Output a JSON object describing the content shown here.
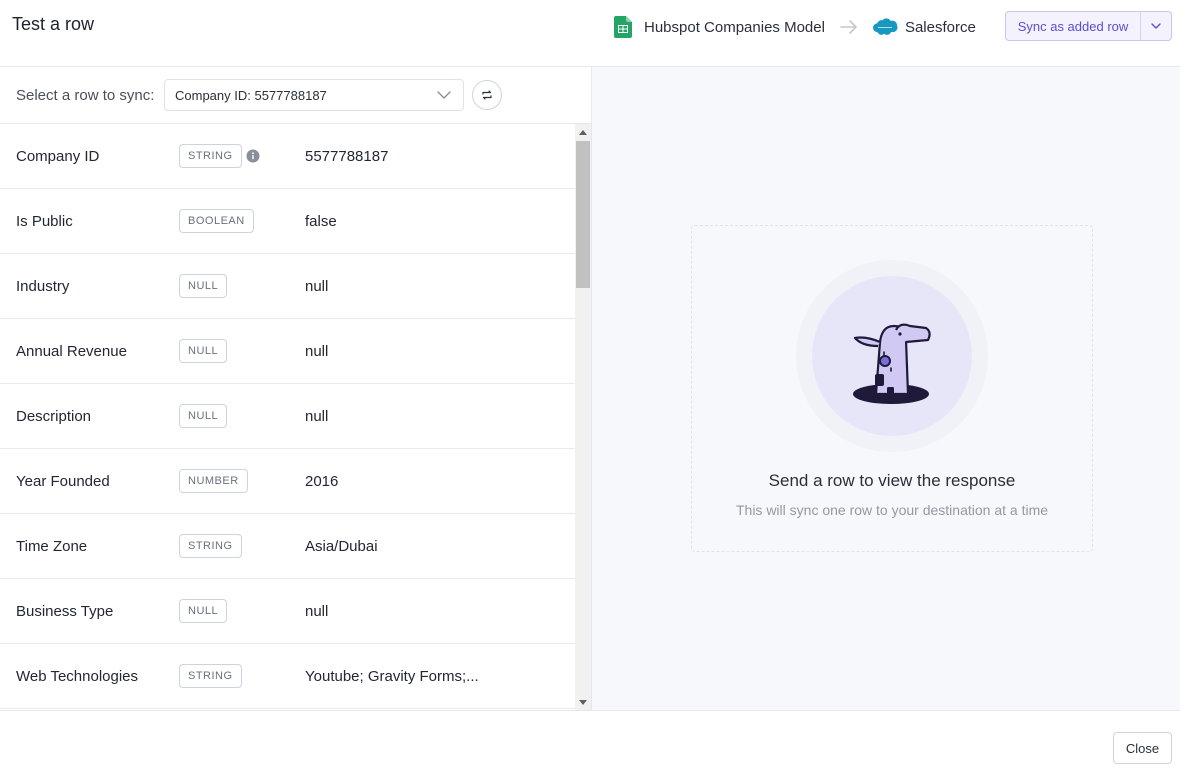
{
  "header": {
    "title": "Test a row",
    "source": {
      "name": "Hubspot Companies Model",
      "icon": "google-sheets-icon"
    },
    "destination": {
      "name": "Salesforce",
      "icon": "salesforce-icon"
    },
    "sync_button": {
      "label": "Sync as added row"
    }
  },
  "selector": {
    "label": "Select a row to sync:",
    "selected_value": "Company ID: 5577788187"
  },
  "rows": [
    {
      "name": "Company ID",
      "type": "STRING",
      "value": "5577788187",
      "has_info": true
    },
    {
      "name": "Is Public",
      "type": "BOOLEAN",
      "value": "false"
    },
    {
      "name": "Industry",
      "type": "NULL",
      "value": "null"
    },
    {
      "name": "Annual Revenue",
      "type": "NULL",
      "value": "null"
    },
    {
      "name": "Description",
      "type": "NULL",
      "value": "null"
    },
    {
      "name": "Year Founded",
      "type": "NUMBER",
      "value": "2016"
    },
    {
      "name": "Time Zone",
      "type": "STRING",
      "value": "Asia/Dubai"
    },
    {
      "name": "Business Type",
      "type": "NULL",
      "value": "null"
    },
    {
      "name": "Web Technologies",
      "type": "STRING",
      "value": "Youtube; Gravity Forms;..."
    }
  ],
  "empty_state": {
    "title": "Send a row to view the response",
    "subtitle": "This will sync one row to your destination at a time"
  },
  "footer": {
    "close_label": "Close"
  },
  "colors": {
    "accent": "#5b4fd6",
    "accent_bg": "#f3f2fd",
    "sheets_green": "#23a566",
    "salesforce_blue": "#1798c1",
    "illustration_dark": "#1f1a3a",
    "illustration_light": "#cfc9f3"
  }
}
